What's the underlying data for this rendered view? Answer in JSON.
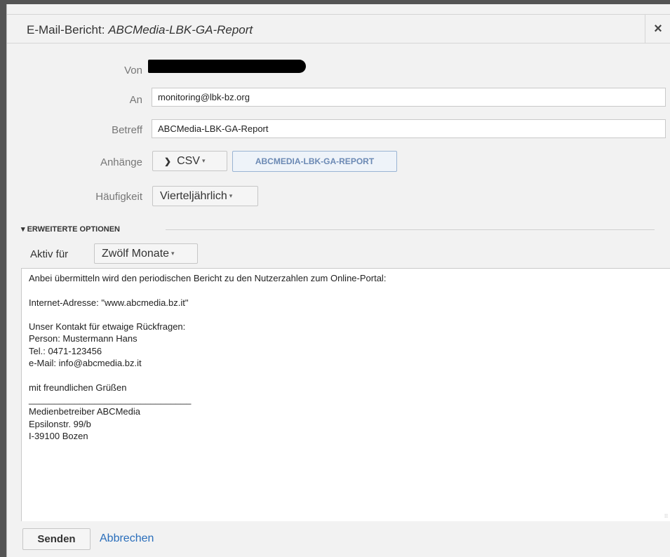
{
  "dialog": {
    "title_prefix": "E-Mail-Bericht: ",
    "title_report": "ABCMedia-LBK-GA-Report",
    "close_label": "×"
  },
  "form": {
    "from_label": "Von",
    "to_label": "An",
    "to_value": "monitoring@lbk-bz.org",
    "subject_label": "Betreff",
    "subject_value": "ABCMedia-LBK-GA-Report",
    "attachments_label": "Anhänge",
    "attachment_format_icon": "❯",
    "attachment_format": "CSV",
    "attachment_report": "ABCMEDIA-LBK-GA-REPORT",
    "frequency_label": "Häufigkeit",
    "frequency_value": "Vierteljährlich"
  },
  "advanced": {
    "toggle_label": "▾ ERWEITERTE OPTIONEN",
    "active_label": "Aktiv für",
    "active_value": "Zwölf Monate"
  },
  "message": {
    "body": "Anbei übermitteln wird den periodischen Bericht zu den Nutzerzahlen zum Online-Portal:\n\nInternet-Adresse: \"www.abcmedia.bz.it\"\n\nUnser Kontakt für etwaige Rückfragen:\nPerson: Mustermann Hans\nTel.: 0471-123456\ne-Mail: info@abcmedia.bz.it\n\nmit freundlichen Grüßen\n________________________________\nMedienbetreiber ABCMedia\nEpsilonstr. 99/b\nI-39100 Bozen"
  },
  "footer": {
    "send_label": "Senden",
    "cancel_label": "Abbrechen"
  },
  "caret_glyph": "▾",
  "colors": {
    "link": "#2a6ebb",
    "chip_text": "#6b89b4",
    "chip_border": "#9ab4d3"
  }
}
